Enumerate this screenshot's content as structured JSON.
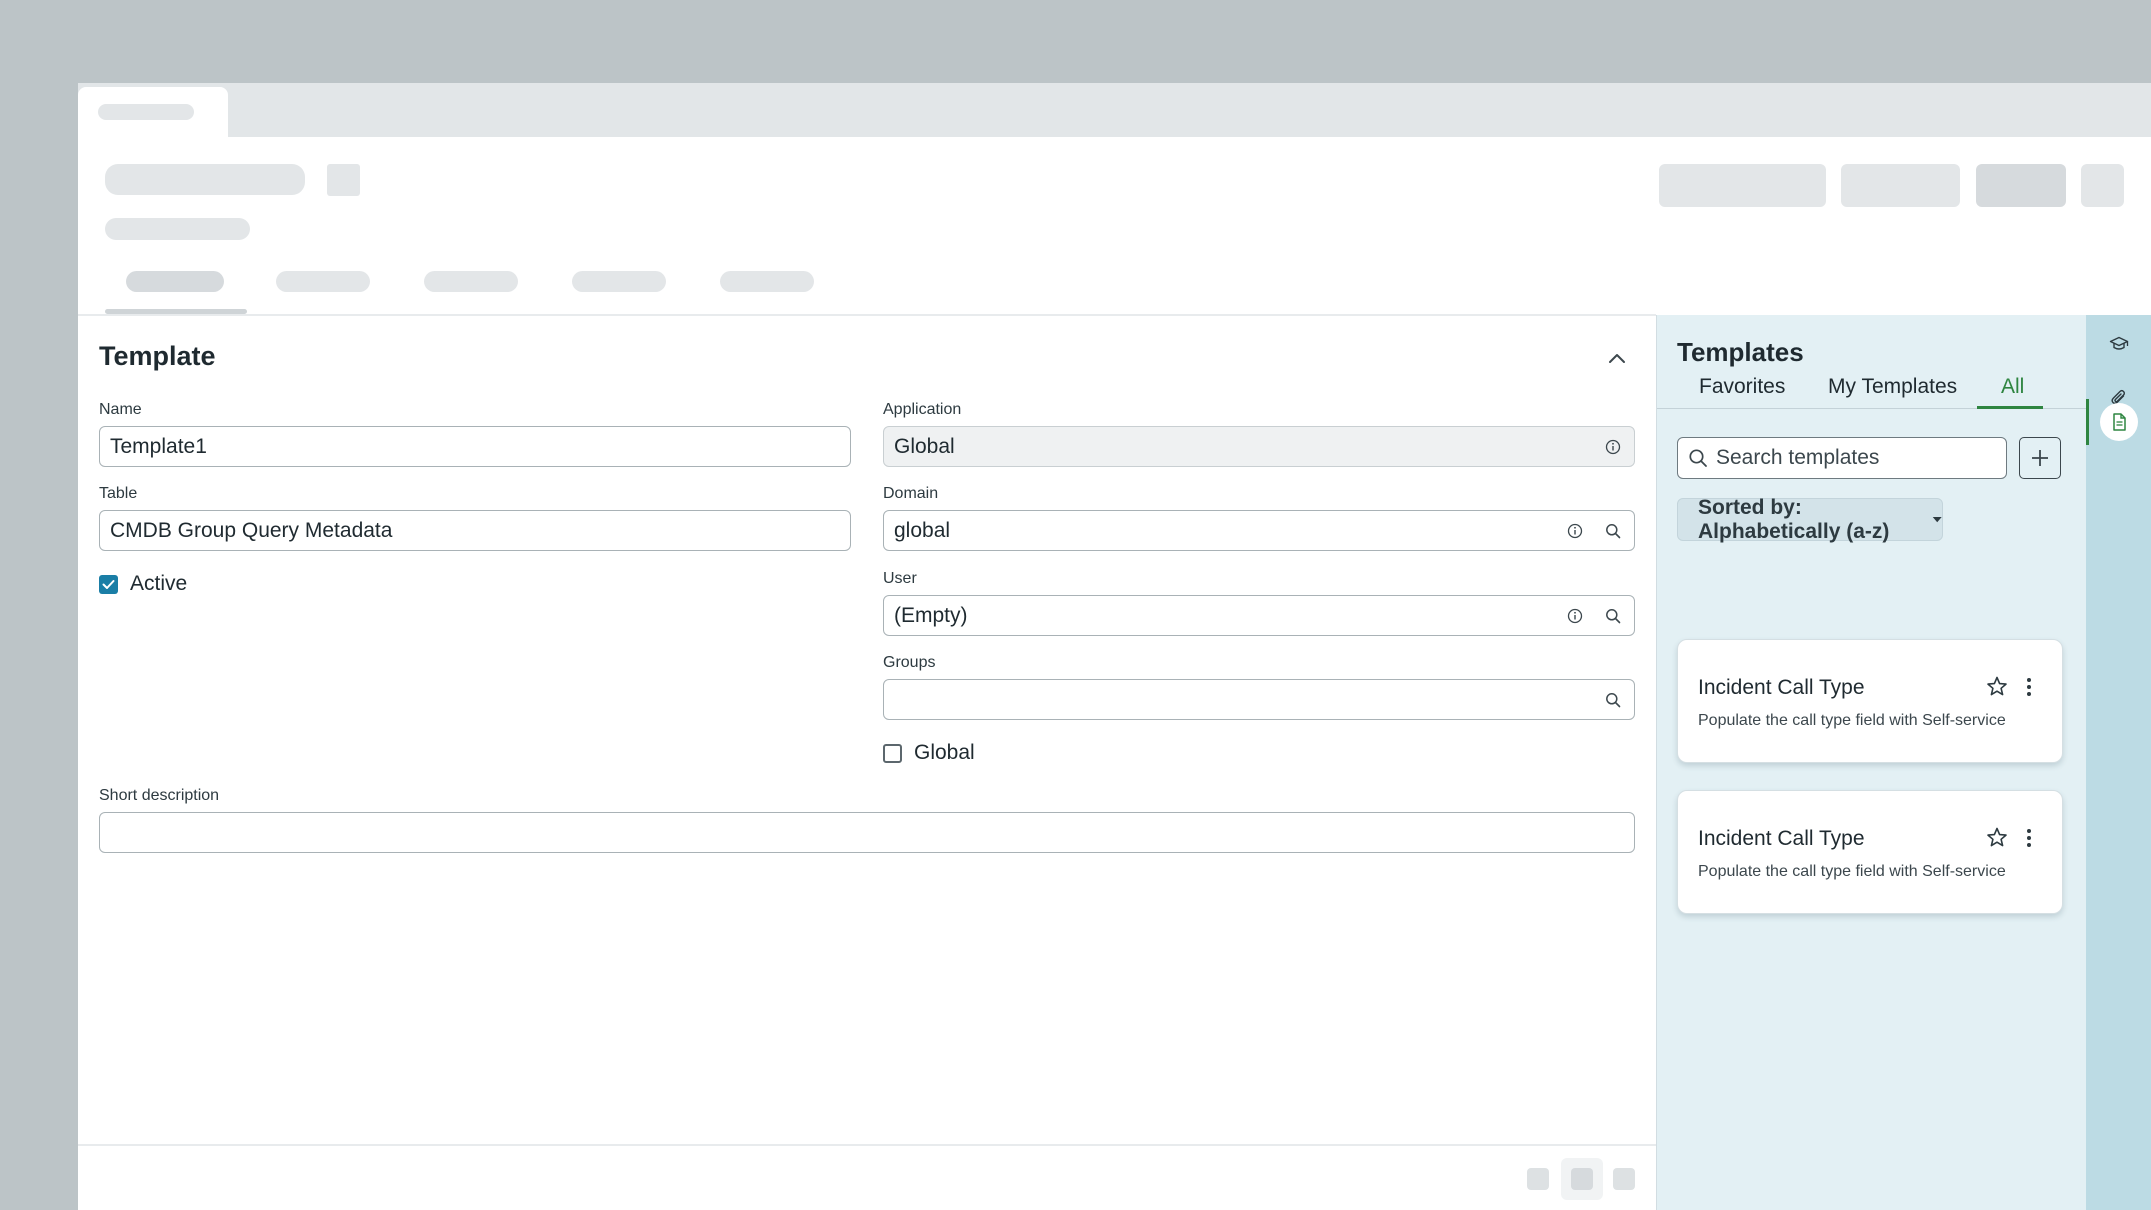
{
  "form": {
    "title": "Template",
    "name_label": "Name",
    "name_value": "Template1",
    "table_label": "Table",
    "table_value": "CMDB Group Query Metadata",
    "active_label": "Active",
    "active_checked": true,
    "application_label": "Application",
    "application_value": "Global",
    "domain_label": "Domain",
    "domain_value": "global",
    "user_label": "User",
    "user_value": "(Empty)",
    "groups_label": "Groups",
    "groups_value": "",
    "global_label": "Global",
    "global_checked": false,
    "short_description_label": "Short description",
    "short_description_value": ""
  },
  "templates_panel": {
    "title": "Templates",
    "tabs": [
      {
        "label": "Favorites"
      },
      {
        "label": "My Templates"
      },
      {
        "label": "All",
        "selected": true
      }
    ],
    "search_placeholder": "Search templates",
    "sort_label": "Sorted by: Alphabetically (a-z)",
    "cards": [
      {
        "title": "Incident Call Type",
        "description": "Populate the call type field with Self-service"
      },
      {
        "title": "Incident Call Type",
        "description": "Populate the call type field with Self-service"
      }
    ]
  },
  "icons": {
    "rail": [
      "graduation-cap-icon",
      "paperclip-icon",
      "document-icon"
    ]
  },
  "colors": {
    "accent_green": "#2e8540",
    "checkbox_blue": "#1a7ea6",
    "panel_bg": "#e3f0f4",
    "rail_bg": "#bcdbe4"
  }
}
